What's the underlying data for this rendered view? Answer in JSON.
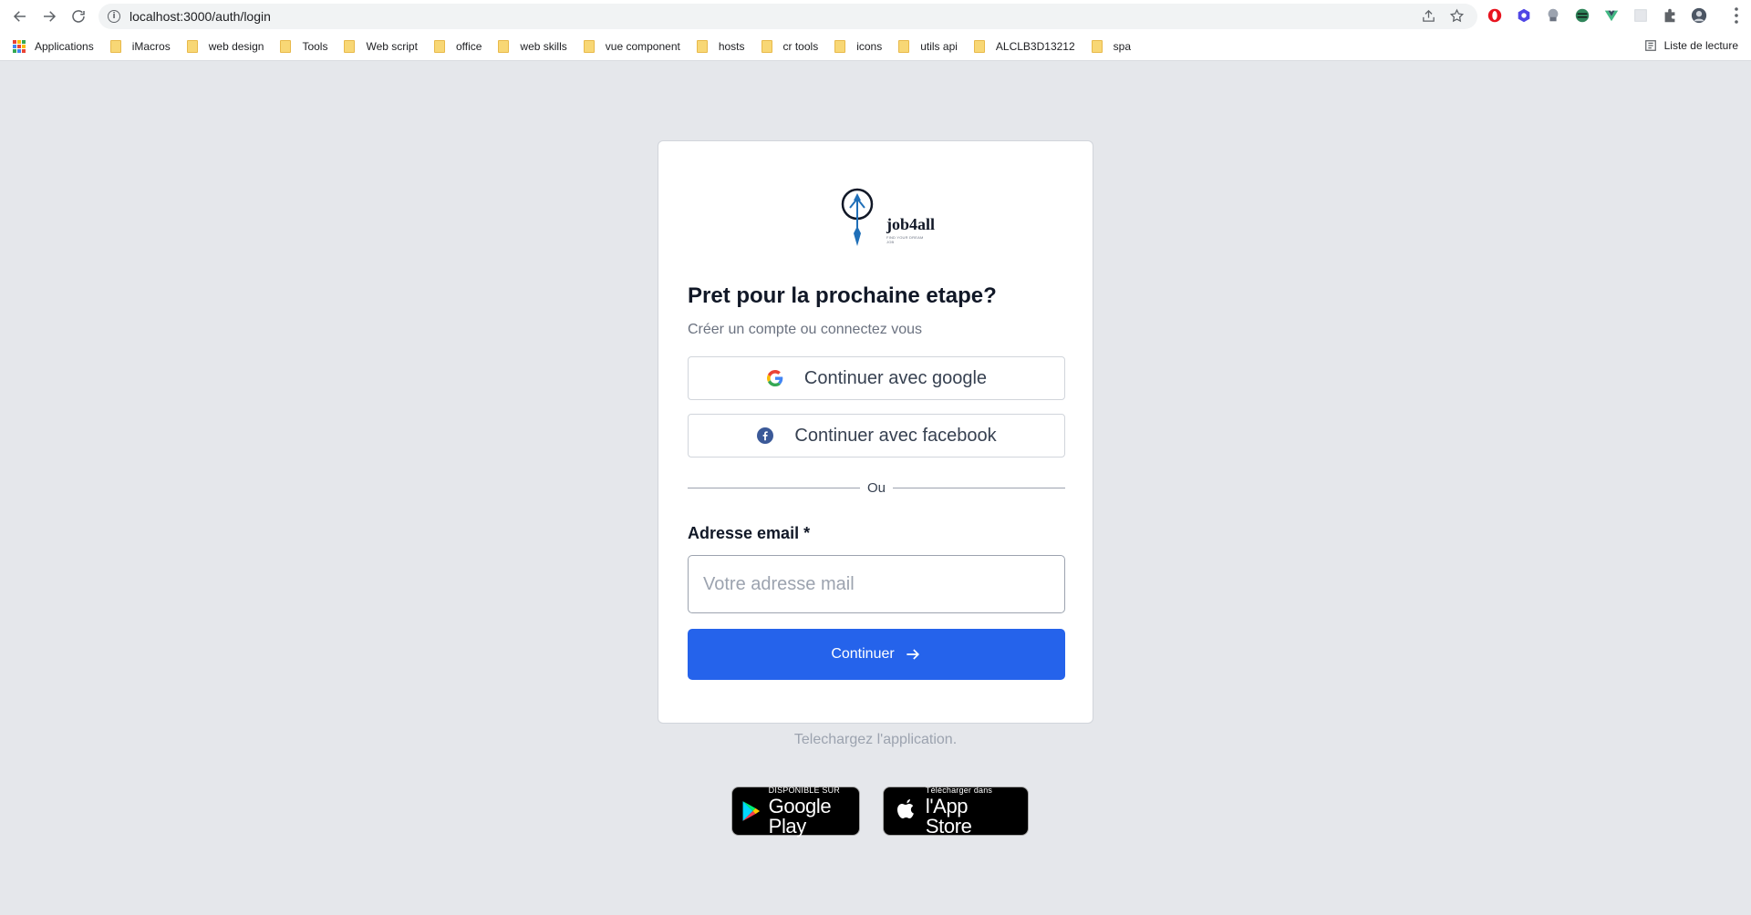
{
  "browser": {
    "url": "localhost:3000/auth/login",
    "bookmarks": {
      "apps_label": "Applications",
      "folders": [
        "iMacros",
        "web design",
        "Tools",
        "Web script",
        "office",
        "web skills",
        "vue component",
        "hosts",
        "cr tools",
        "icons",
        "utils api",
        "ALCLB3D13212",
        "spa"
      ]
    },
    "reading_list_label": "Liste de lecture"
  },
  "logo": {
    "name": "job4all",
    "tagline": "FIND YOUR DREAM JOB"
  },
  "login": {
    "heading": "Pret pour la prochaine etape?",
    "subtext": "Créer un compte ou connectez vous",
    "google_label": "Continuer avec google",
    "facebook_label": "Continuer avec facebook",
    "divider_text": "Ou",
    "email_label": "Adresse email *",
    "email_placeholder": "Votre adresse mail",
    "email_value": "",
    "continue_label": "Continuer"
  },
  "download": {
    "text": "Telechargez l'application.",
    "google_play_small": "DISPONIBLE SUR",
    "google_play_big": "Google Play",
    "app_store_small": "Télécharger dans",
    "app_store_big": "l'App Store"
  },
  "colors": {
    "page_bg": "#e5e7eb",
    "primary": "#2563eb",
    "card_bg": "#ffffff"
  }
}
